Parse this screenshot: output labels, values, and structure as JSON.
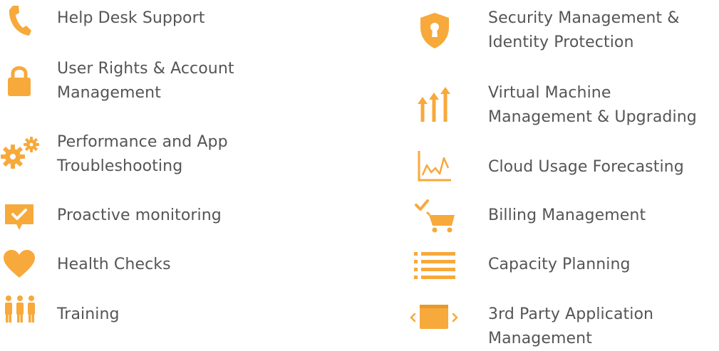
{
  "accent_color": "#F7A93B",
  "text_color": "#555555",
  "left_column": [
    {
      "icon": "phone-icon",
      "lines": [
        "Help Desk Support"
      ]
    },
    {
      "icon": "lock-icon",
      "lines": [
        "User Rights & Account",
        "Management"
      ]
    },
    {
      "icon": "gears-icon",
      "lines": [
        "Performance and App",
        "Troubleshooting"
      ]
    },
    {
      "icon": "monitor-check-icon",
      "lines": [
        "Proactive monitoring"
      ]
    },
    {
      "icon": "heart-icon",
      "lines": [
        "Health Checks"
      ]
    },
    {
      "icon": "people-icon",
      "lines": [
        "Training"
      ]
    }
  ],
  "right_column": [
    {
      "icon": "shield-lock-icon",
      "lines": [
        "Security Management &",
        "Identity Protection"
      ]
    },
    {
      "icon": "upgrade-arrows-icon",
      "lines": [
        "Virtual Machine",
        "Management & Upgrading"
      ]
    },
    {
      "icon": "line-chart-icon",
      "lines": [
        "Cloud Usage Forecasting"
      ]
    },
    {
      "icon": "cart-check-icon",
      "lines": [
        "Billing Management"
      ]
    },
    {
      "icon": "list-icon",
      "lines": [
        "Capacity Planning"
      ]
    },
    {
      "icon": "app-window-icon",
      "lines": [
        "3rd Party Application",
        "Management"
      ]
    }
  ]
}
